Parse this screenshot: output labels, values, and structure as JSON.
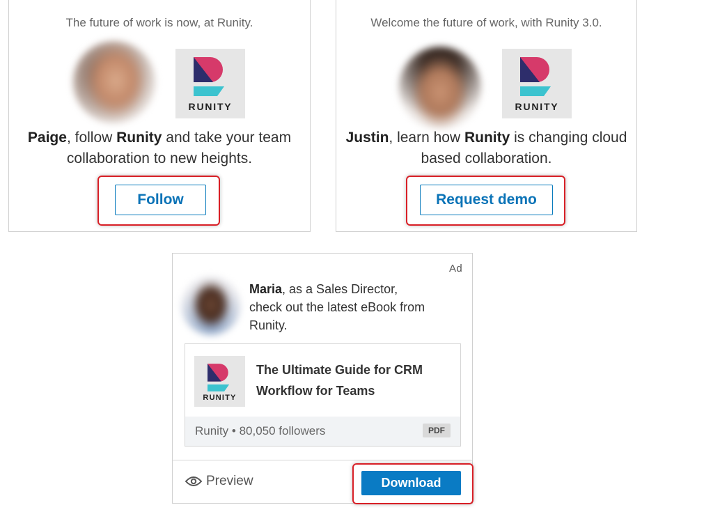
{
  "ad_label": "Ad",
  "brand": {
    "name": "Runity",
    "logo_word": "RUNITY",
    "colors": {
      "pink": "#d63a6a",
      "navy": "#2d2d6b",
      "teal": "#3cc3cf",
      "tile": "#e6e6e6"
    }
  },
  "card1": {
    "tagline": "The future of work is now, at Runity.",
    "message": {
      "name": "Paige",
      "mid": ", follow ",
      "brand": "Runity",
      "rest": " and take your team collaboration to new heights."
    },
    "button": "Follow"
  },
  "card2": {
    "tagline": "Welcome the future of work, with Runity 3.0.",
    "message": {
      "name": "Justin",
      "mid": ", learn how ",
      "brand": "Runity",
      "rest": " is changing cloud based collaboration."
    },
    "button": "Request demo"
  },
  "card3": {
    "message": {
      "name": "Maria",
      "rest": ", as a Sales Director, check out the latest eBook from Runity."
    },
    "document": {
      "title": "The Ultimate Guide for CRM Workflow for Teams",
      "meta": "Runity • 80,050 followers",
      "badge": "PDF"
    },
    "preview_label": "Preview",
    "download_label": "Download"
  },
  "accent_color": "#0a7bc4",
  "highlight_color": "#d81f26"
}
